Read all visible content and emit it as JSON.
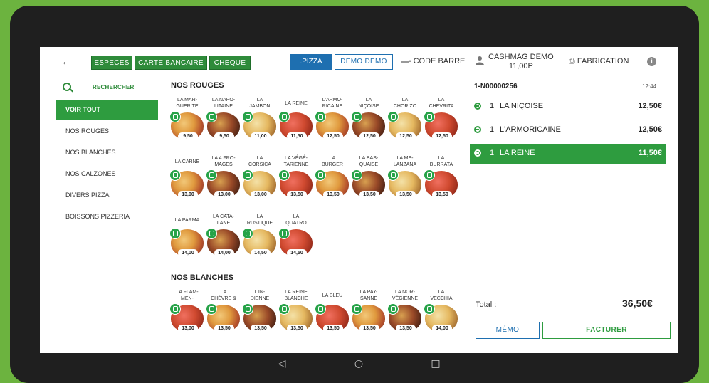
{
  "topbar": {
    "back_icon": "arrow-left-icon",
    "payment_buttons": [
      "ESPECES",
      "CARTE BANCAIRE",
      "CHEQUE"
    ],
    "pizza_button": ".PIZZA",
    "demo_button": "DEMO DEMO",
    "barcode_label": "CODE BARRE",
    "user_name": "CASHMAG DEMO",
    "user_amount": "11,00P",
    "fabrication_label": "FABRICATION",
    "info_label": "i"
  },
  "sidebar": {
    "search_label": "RECHERCHER",
    "items": [
      "VOIR TOUT",
      "NOS ROUGES",
      "NOS BLANCHES",
      "NOS CALZONES",
      "DIVERS PIZZA",
      "BOISSONS PIZZERIA"
    ],
    "active_index": 0
  },
  "catalog": {
    "sections": [
      {
        "title": "NOS ROUGES",
        "products": [
          {
            "name": "LA MAR-\nGUERITE",
            "price": "9,50"
          },
          {
            "name": "LA NAPO-\nLITAINE",
            "price": "9,50"
          },
          {
            "name": "LA\nJAMBON",
            "price": "11,00"
          },
          {
            "name": "LA REINE",
            "price": "11,50"
          },
          {
            "name": "L'ARMO-\nRICAINE",
            "price": "12,50"
          },
          {
            "name": "LA\nNIÇOISE",
            "price": "12,50"
          },
          {
            "name": "LA\nCHORIZO",
            "price": "12,50"
          },
          {
            "name": "LA\nCHEVRITA",
            "price": "12,50"
          },
          {
            "name": "LA CARNE",
            "price": "13,00"
          },
          {
            "name": "LA 4 FRO-\nMAGES",
            "price": "13,00"
          },
          {
            "name": "LA\nCORSICA",
            "price": "13,00"
          },
          {
            "name": "LA VÉGÉ-\nTARIENNE",
            "price": "13,50"
          },
          {
            "name": "LA\nBURGER",
            "price": "13,50"
          },
          {
            "name": "LA BAS-\nQUAISE",
            "price": "13,50"
          },
          {
            "name": "LA ME-\nLANZANA",
            "price": "13,50"
          },
          {
            "name": "LA\nBURRATA",
            "price": "13,50"
          },
          {
            "name": "LA PARMA",
            "price": "14,00"
          },
          {
            "name": "LA CATA-\nLANE",
            "price": "14,00"
          },
          {
            "name": "LA\nRUSTIQUE",
            "price": "14,50"
          },
          {
            "name": "LA\nQUATRO",
            "price": "14,50"
          }
        ]
      },
      {
        "title": "NOS BLANCHES",
        "products": [
          {
            "name": "LA FLAM-\nMEN-",
            "price": "13,00"
          },
          {
            "name": "LA\nCHÈVRE &",
            "price": "13,50"
          },
          {
            "name": "L'IN-\nDIENNE",
            "price": "13,50"
          },
          {
            "name": "LA REINE\nBLANCHE",
            "price": "13,50"
          },
          {
            "name": "LA BLEU",
            "price": "13,50"
          },
          {
            "name": "LA PAY-\nSANNE",
            "price": "13,50"
          },
          {
            "name": "LA NOR-\nVÉGIENNE",
            "price": "13,50"
          },
          {
            "name": "LA\nVECCHIA",
            "price": "14,00"
          }
        ]
      }
    ]
  },
  "order": {
    "number": "1-N00000256",
    "time": "12:44",
    "lines": [
      {
        "qty": "1",
        "name": "LA NIÇOISE",
        "price": "12,50€"
      },
      {
        "qty": "1",
        "name": "L'ARMORICAINE",
        "price": "12,50€"
      },
      {
        "qty": "1",
        "name": "LA REINE",
        "price": "11,50€"
      }
    ],
    "active_line": 2,
    "total_label": "Total :",
    "total_value": "36,50€",
    "memo_button": "MÉMO",
    "invoice_button": "FACTURER"
  },
  "android_nav": {
    "back": "◁",
    "home": "○",
    "recent": "□"
  },
  "colors": {
    "green": "#2e9c3f",
    "blue": "#1e6fb0",
    "background": "#6cb33f"
  }
}
